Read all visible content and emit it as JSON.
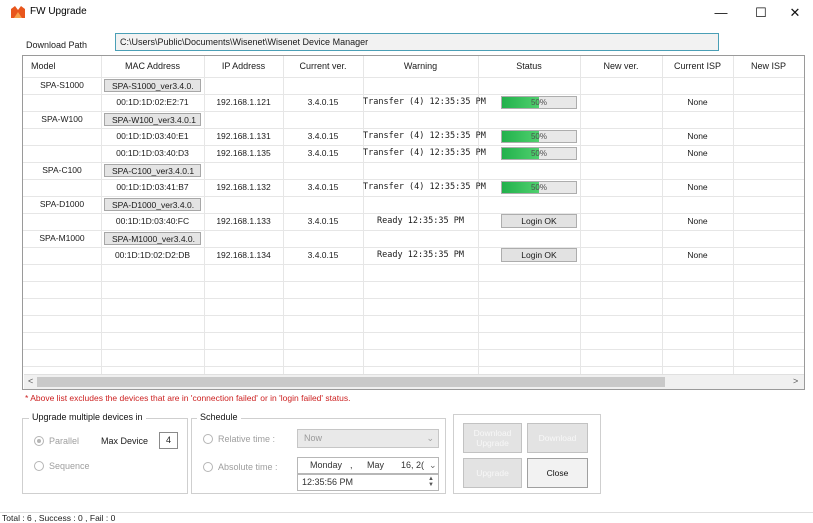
{
  "window": {
    "title": "FW Upgrade",
    "controls": {
      "minimize": "—",
      "maximize": "☐",
      "close": "✕"
    }
  },
  "download_path": {
    "label": "Download Path",
    "value": "C:\\Users\\Public\\Documents\\Wisenet\\Wisenet Device Manager"
  },
  "table": {
    "headers": [
      "Model",
      "MAC Address",
      "IP Address",
      "Current ver.",
      "Warning",
      "Status",
      "New ver.",
      "Current ISP",
      "New ISP"
    ],
    "groups": [
      {
        "model": "SPA-S1000",
        "version_tag": "SPA-S1000_ver3.4.0.",
        "devices": [
          {
            "mac": "00:1D:1D:02:E2:71",
            "ip": "192.168.1.121",
            "current_ver": "3.4.0.15",
            "warning": "Transfer (4) 12:35:35 PM",
            "status_type": "progress",
            "progress_text": "50%",
            "progress_value": 0.5,
            "current_isp": "None"
          }
        ]
      },
      {
        "model": "SPA-W100",
        "version_tag": "SPA-W100_ver3.4.0.1",
        "devices": [
          {
            "mac": "00:1D:1D:03:40:E1",
            "ip": "192.168.1.131",
            "current_ver": "3.4.0.15",
            "warning": "Transfer (4) 12:35:35 PM",
            "status_type": "progress",
            "progress_text": "50%",
            "progress_value": 0.5,
            "current_isp": "None"
          },
          {
            "mac": "00:1D:1D:03:40:D3",
            "ip": "192.168.1.135",
            "current_ver": "3.4.0.15",
            "warning": "Transfer (4) 12:35:35 PM",
            "status_type": "progress",
            "progress_text": "50%",
            "progress_value": 0.5,
            "current_isp": "None"
          }
        ]
      },
      {
        "model": "SPA-C100",
        "version_tag": "SPA-C100_ver3.4.0.1",
        "devices": [
          {
            "mac": "00:1D:1D:03:41:B7",
            "ip": "192.168.1.132",
            "current_ver": "3.4.0.15",
            "warning": "Transfer (4) 12:35:35 PM",
            "status_type": "progress",
            "progress_text": "50%",
            "progress_value": 0.5,
            "current_isp": "None"
          }
        ]
      },
      {
        "model": "SPA-D1000",
        "version_tag": "SPA-D1000_ver3.4.0.",
        "devices": [
          {
            "mac": "00:1D:1D:03:40:FC",
            "ip": "192.168.1.133",
            "current_ver": "3.4.0.15",
            "warning": "Ready 12:35:35 PM",
            "status_type": "button",
            "status_text": "Login OK",
            "current_isp": "None"
          }
        ]
      },
      {
        "model": "SPA-M1000",
        "version_tag": "SPA-M1000_ver3.4.0.",
        "devices": [
          {
            "mac": "00:1D:1D:02:D2:DB",
            "ip": "192.168.1.134",
            "current_ver": "3.4.0.15",
            "warning": "Ready 12:35:35 PM",
            "status_type": "button",
            "status_text": "Login OK",
            "current_isp": "None"
          }
        ]
      }
    ]
  },
  "scrollbar": {
    "left_arrow": "<",
    "right_arrow": ">"
  },
  "note": "* Above list excludes the devices that are in 'connection failed' or in 'login failed' status.",
  "upgrade_multiple": {
    "title": "Upgrade multiple devices in",
    "parallel_label": "Parallel",
    "sequence_label": "Sequence",
    "selected": "parallel",
    "max_device_label": "Max Device",
    "max_device_value": "4"
  },
  "schedule": {
    "title": "Schedule",
    "relative_label": "Relative time :",
    "absolute_label": "Absolute time :",
    "relative_value": "Now",
    "date_weekday": "Monday",
    "date_sep": ",",
    "date_month": "May",
    "date_day": "16, 2(",
    "time_value": "12:35:56 PM"
  },
  "buttons": {
    "download_upgrade": "Download Upgrade",
    "download": "Download",
    "upgrade": "Upgrade",
    "close": "Close"
  },
  "status_bar": "Total : 6 , Success : 0 , Fail : 0",
  "colors": {
    "progress_fill": "#22b14c",
    "note_red": "#cc1f1f",
    "path_border": "#4a9fb6",
    "icon_orange": "#e8561c"
  }
}
